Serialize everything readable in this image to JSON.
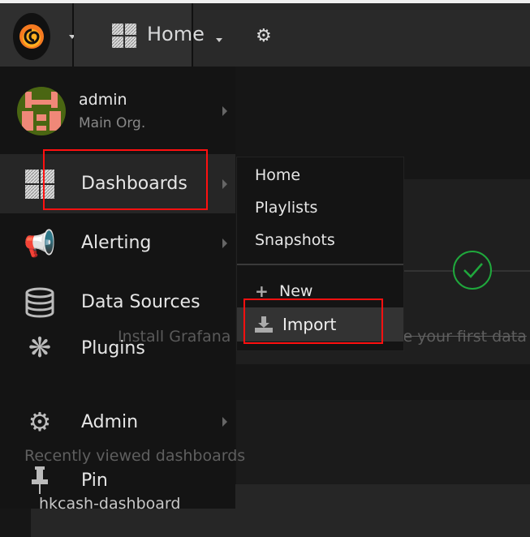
{
  "topbar": {
    "home_label": "Home"
  },
  "user": {
    "name": "admin",
    "org": "Main Org."
  },
  "sidemenu": {
    "items": [
      {
        "label": "Dashboards",
        "icon": "dashboard-grid-icon",
        "has_submenu": true,
        "active": true
      },
      {
        "label": "Alerting",
        "icon": "megaphone-icon",
        "has_submenu": true
      },
      {
        "label": "Data Sources",
        "icon": "database-icon",
        "has_submenu": false
      },
      {
        "label": "Plugins",
        "icon": "plugins-icon",
        "has_submenu": false
      },
      {
        "label": "Admin",
        "icon": "gears-icon",
        "has_submenu": true
      },
      {
        "label": "Pin",
        "icon": "pin-icon",
        "has_submenu": false
      }
    ]
  },
  "submenu": {
    "items": [
      "Home",
      "Playlists",
      "Snapshots"
    ],
    "new_label": "New",
    "import_label": "Import"
  },
  "background": {
    "install": "Install Grafana",
    "create": "Create your first data",
    "recent": "Recently viewed dashboards",
    "dashboard": "hkcash-dashboard"
  },
  "colors": {
    "highlight": "#ff1010",
    "success": "#1fa83c",
    "logo": "#f57a20"
  }
}
